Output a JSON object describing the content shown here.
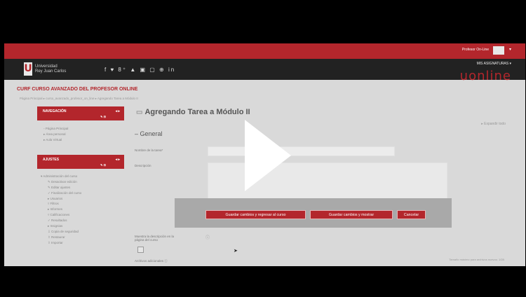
{
  "topbar": {
    "user_name": "Profesor On-Line",
    "caret": "▾"
  },
  "header": {
    "logo_letter": "U",
    "university_line1": "Universidad",
    "university_line2": "Rey Juan Carlos",
    "social": "f ♥ 8⁺ ▲ ▣ ▢ ⊕ in",
    "mis_asignaturas": "MIS ASIGNATURAS ▾",
    "brand": "uonline"
  },
  "course": {
    "title": "CURF  CURSO AVANZADO DEL PROFESOR ONLINE",
    "breadcrumb": "Página Principal ▸ curso_avanzado_profesor_on_line ▸ Agregando Tarea a Módulo II"
  },
  "nav_block": {
    "title": "NAVEGACIÓN",
    "controls": "◂ ▸",
    "sub": "✎ ⊟",
    "items": [
      "Página Principal",
      "Área personal",
      "Aula Virtual"
    ]
  },
  "ajustes_block": {
    "title": "AJUSTES",
    "controls": "◂ ▸",
    "sub": "✎ ⊟",
    "root": "Administración del curso",
    "items": [
      "Desactivar edición",
      "Editar ajustes",
      "Finalización del curso",
      "Usuarios",
      "Filtros",
      "Informes",
      "Calificaciones",
      "Resultados",
      "Insignias",
      "Copia de seguridad",
      "Restaurar",
      "Importar"
    ]
  },
  "main": {
    "heading": "Agregando Tarea a Módulo II",
    "expand_all": "▸ Expandir todo",
    "section": "– General",
    "name_label": "Nombre de la tarea*",
    "description_label": "Descripción",
    "show_desc_label_1": "Muestra la descripción en la",
    "show_desc_label_2": "página del curso",
    "extra_files_label": "Archivos adicionales",
    "max_size": "Tamaño máximo para archivos nuevos: 1GB"
  },
  "buttons": {
    "save_return": "Guardar cambios y regresar al curso",
    "save_show": "Guardar cambios y mostrar",
    "cancel": "Cancelar"
  },
  "colors": {
    "accent": "#b3262c",
    "header": "#222222",
    "page": "#d9d9d9",
    "overlay": "#a9a9a9"
  },
  "icons": {
    "play": "play-icon",
    "help": "help-icon",
    "pointer": "mouse-pointer-icon"
  }
}
